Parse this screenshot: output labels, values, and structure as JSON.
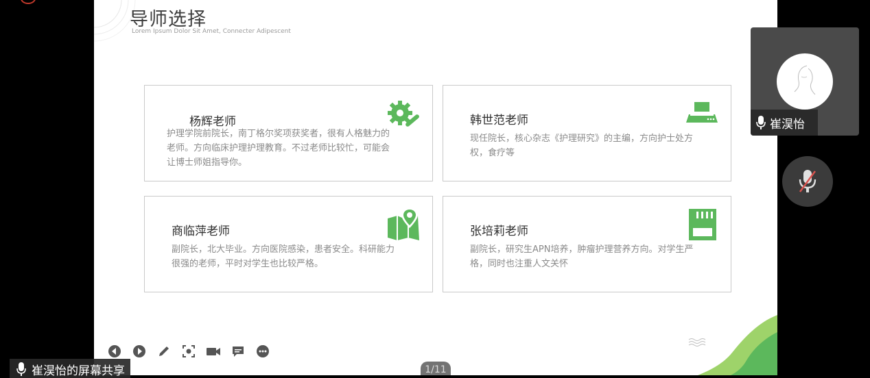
{
  "slide": {
    "title": "导师选择",
    "subtitle": "Lorem Ipsum Dolor Sit Amet, Connecter Adipescent",
    "cards": [
      {
        "name": "杨辉老师",
        "description": "护理学院前院长，南丁格尔奖项获奖者，很有人格魅力的老师。方向临床护理护理教育。不过老师比较忙，可能会让博士师姐指导你。",
        "icon": "gear-wrench-icon"
      },
      {
        "name": "韩世范老师",
        "description": "现任院长，核心杂志《护理研究》的主编，方向护士处方权，食疗等",
        "icon": "range-hood-icon"
      },
      {
        "name": "商临萍老师",
        "description": "副院长，北大毕业。方向医院感染，患者安全。科研能力很强的老师，平时对学生也比较严格。",
        "icon": "map-pin-icon"
      },
      {
        "name": "张培莉老师",
        "description": "副院长，研究生APN培养，肿瘤护理营养方向。对学生严格，同时也注重人文关怀",
        "icon": "sd-card-icon"
      }
    ]
  },
  "controls": {
    "page_indicator": "1/11",
    "buttons": [
      "prev-icon",
      "next-icon",
      "pen-icon",
      "screenshot-icon",
      "camera-icon",
      "chat-icon",
      "more-icon"
    ]
  },
  "share": {
    "label": "崔淏怡的屏幕共享"
  },
  "participant": {
    "name": "崔淏怡"
  },
  "colors": {
    "accent_green": "#5cb85c",
    "slide_bg": "#ffffff",
    "card_border": "#c9c9c9"
  }
}
